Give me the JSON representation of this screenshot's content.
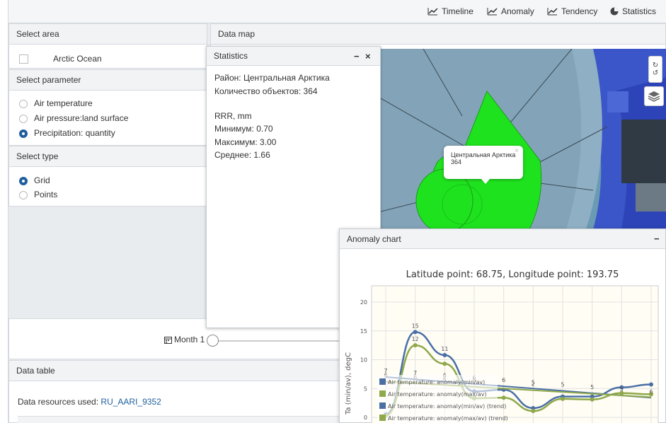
{
  "nav": {
    "timeline": "Timeline",
    "anomaly": "Anomaly",
    "tendency": "Tendency",
    "statistics": "Statistics"
  },
  "select_area": {
    "title": "Select area",
    "items": [
      {
        "label": "Arctic Ocean",
        "checked": false
      }
    ]
  },
  "select_parameter": {
    "title": "Select parameter",
    "options": [
      {
        "label": "Air temperature",
        "selected": false
      },
      {
        "label": "Air pressure:land surface",
        "selected": false
      },
      {
        "label": "Precipitation: quantity",
        "selected": true
      }
    ]
  },
  "select_type": {
    "title": "Select type",
    "options": [
      {
        "label": "Grid",
        "selected": true
      },
      {
        "label": "Points",
        "selected": false
      }
    ]
  },
  "data_map": {
    "title": "Data map",
    "popup": {
      "name": "Центральная Арктика",
      "count": "364",
      "close": "×"
    },
    "controls": {
      "redo": "↻",
      "undo": "↺"
    }
  },
  "statistics_window": {
    "title": "Statistics",
    "minimize": "−",
    "close": "×",
    "region": "Район: Центральная Арктика",
    "count": "Количество объектов: 364",
    "unit": "RRR, mm",
    "min": "Минимум: 0.70",
    "max": "Максимум: 3.00",
    "mean": "Среднее: 1.66"
  },
  "slider": {
    "label": "Month 1",
    "value": 0
  },
  "data_table": {
    "title": "Data table",
    "resources_label": "Data resources used: ",
    "resource_link": "RU_AARI_9352"
  },
  "anomaly_window": {
    "title": "Anomaly chart",
    "minimize": "−"
  },
  "colors": {
    "accent": "#1f5f9e",
    "series_blue": "#4a6fa5",
    "series_green": "#8fa84a",
    "map_green": "#1fe21f"
  },
  "chart_data": {
    "type": "line",
    "title": "Latitude point: 68.75, Longitude point: 193.75",
    "ylabel": "Ta (min/av), degC",
    "xlabel": "",
    "ylim": [
      0,
      20
    ],
    "yticks": [
      0,
      5,
      10,
      15,
      20
    ],
    "x": [
      0,
      1,
      2,
      3,
      4,
      5,
      6,
      7,
      8,
      9
    ],
    "series": [
      {
        "name": "Air temperature: anomaly(min/av)",
        "values": [
          0.5,
          14.8,
          10.8,
          4.5,
          4.8,
          1.6,
          3.6,
          3.6,
          5.2,
          5.7
        ],
        "labels": [
          "",
          "15",
          "11",
          "",
          "",
          "",
          "",
          "",
          "",
          ""
        ]
      },
      {
        "name": "Air temperature: anomaly(max/av)",
        "values": [
          0.3,
          12.5,
          9.3,
          3.3,
          3.4,
          1.1,
          3.2,
          3.1,
          4.2,
          4.0
        ],
        "labels": [
          "",
          "12",
          "",
          "",
          "",
          "",
          "",
          "",
          "",
          ""
        ]
      },
      {
        "name": "Air temperature: anomaly(min/av) (trend)",
        "values": [
          7,
          6.6,
          6.2,
          5.8,
          5.4,
          5.0,
          4.6,
          4.2,
          3.8,
          3.4
        ],
        "labels": [
          "7",
          "7",
          "6",
          "6",
          "6",
          "5",
          "5",
          "5",
          "5",
          "6"
        ]
      },
      {
        "name": "Air temperature: anomaly(max/av) (trend)",
        "values": [
          6.2,
          5.9,
          5.6,
          5.3,
          5.0,
          4.7,
          4.4,
          4.1,
          3.8,
          3.5
        ],
        "labels": [
          "6",
          "6",
          "6",
          "5",
          "",
          "2",
          "",
          "",
          "",
          ""
        ]
      }
    ]
  }
}
